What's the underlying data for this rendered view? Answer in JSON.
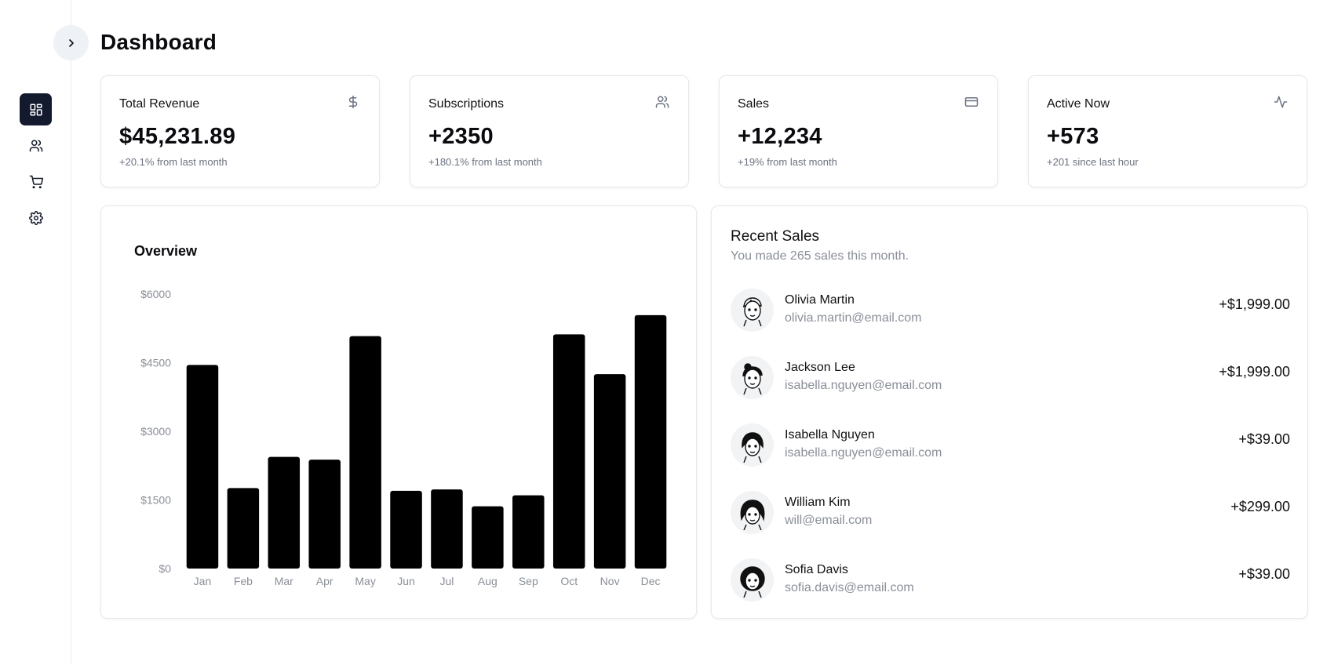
{
  "header": {
    "title": "Dashboard"
  },
  "sidebar": {
    "items": [
      {
        "icon": "dashboard-icon",
        "active": true
      },
      {
        "icon": "users-icon",
        "active": false
      },
      {
        "icon": "cart-icon",
        "active": false
      },
      {
        "icon": "gear-icon",
        "active": false
      }
    ]
  },
  "stats": [
    {
      "label": "Total Revenue",
      "value": "$45,231.89",
      "sub": "+20.1% from last month",
      "icon": "dollar-icon"
    },
    {
      "label": "Subscriptions",
      "value": "+2350",
      "sub": "+180.1% from last month",
      "icon": "users-icon"
    },
    {
      "label": "Sales",
      "value": "+12,234",
      "sub": "+19% from last month",
      "icon": "credit-card-icon"
    },
    {
      "label": "Active Now",
      "value": "+573",
      "sub": "+201 since last hour",
      "icon": "activity-icon"
    }
  ],
  "overview": {
    "title": "Overview"
  },
  "chart_data": {
    "type": "bar",
    "categories": [
      "Jan",
      "Feb",
      "Mar",
      "Apr",
      "May",
      "Jun",
      "Jul",
      "Aug",
      "Sep",
      "Oct",
      "Nov",
      "Dec"
    ],
    "values": [
      4450,
      1760,
      2440,
      2380,
      5080,
      1700,
      1730,
      1360,
      1600,
      5120,
      4250,
      5540
    ],
    "yticks": [
      "$0",
      "$1500",
      "$3000",
      "$4500",
      "$6000"
    ],
    "ylim": [
      0,
      6000
    ],
    "bar_color": "#000000",
    "grid": false,
    "title": "Overview"
  },
  "recent_sales": {
    "title": "Recent Sales",
    "subtitle": "You made 265 sales this month.",
    "items": [
      {
        "name": "Olivia Martin",
        "email": "olivia.martin@email.com",
        "amount": "+$1,999.00"
      },
      {
        "name": "Jackson Lee",
        "email": "isabella.nguyen@email.com",
        "amount": "+$1,999.00"
      },
      {
        "name": "Isabella Nguyen",
        "email": "isabella.nguyen@email.com",
        "amount": "+$39.00"
      },
      {
        "name": "William Kim",
        "email": "will@email.com",
        "amount": "+$299.00"
      },
      {
        "name": "Sofia Davis",
        "email": "sofia.davis@email.com",
        "amount": "+$39.00"
      }
    ]
  },
  "colors": {
    "sidebar_active": "#131a2e",
    "muted_text": "#8a8f98",
    "border": "#e6e8ec"
  }
}
